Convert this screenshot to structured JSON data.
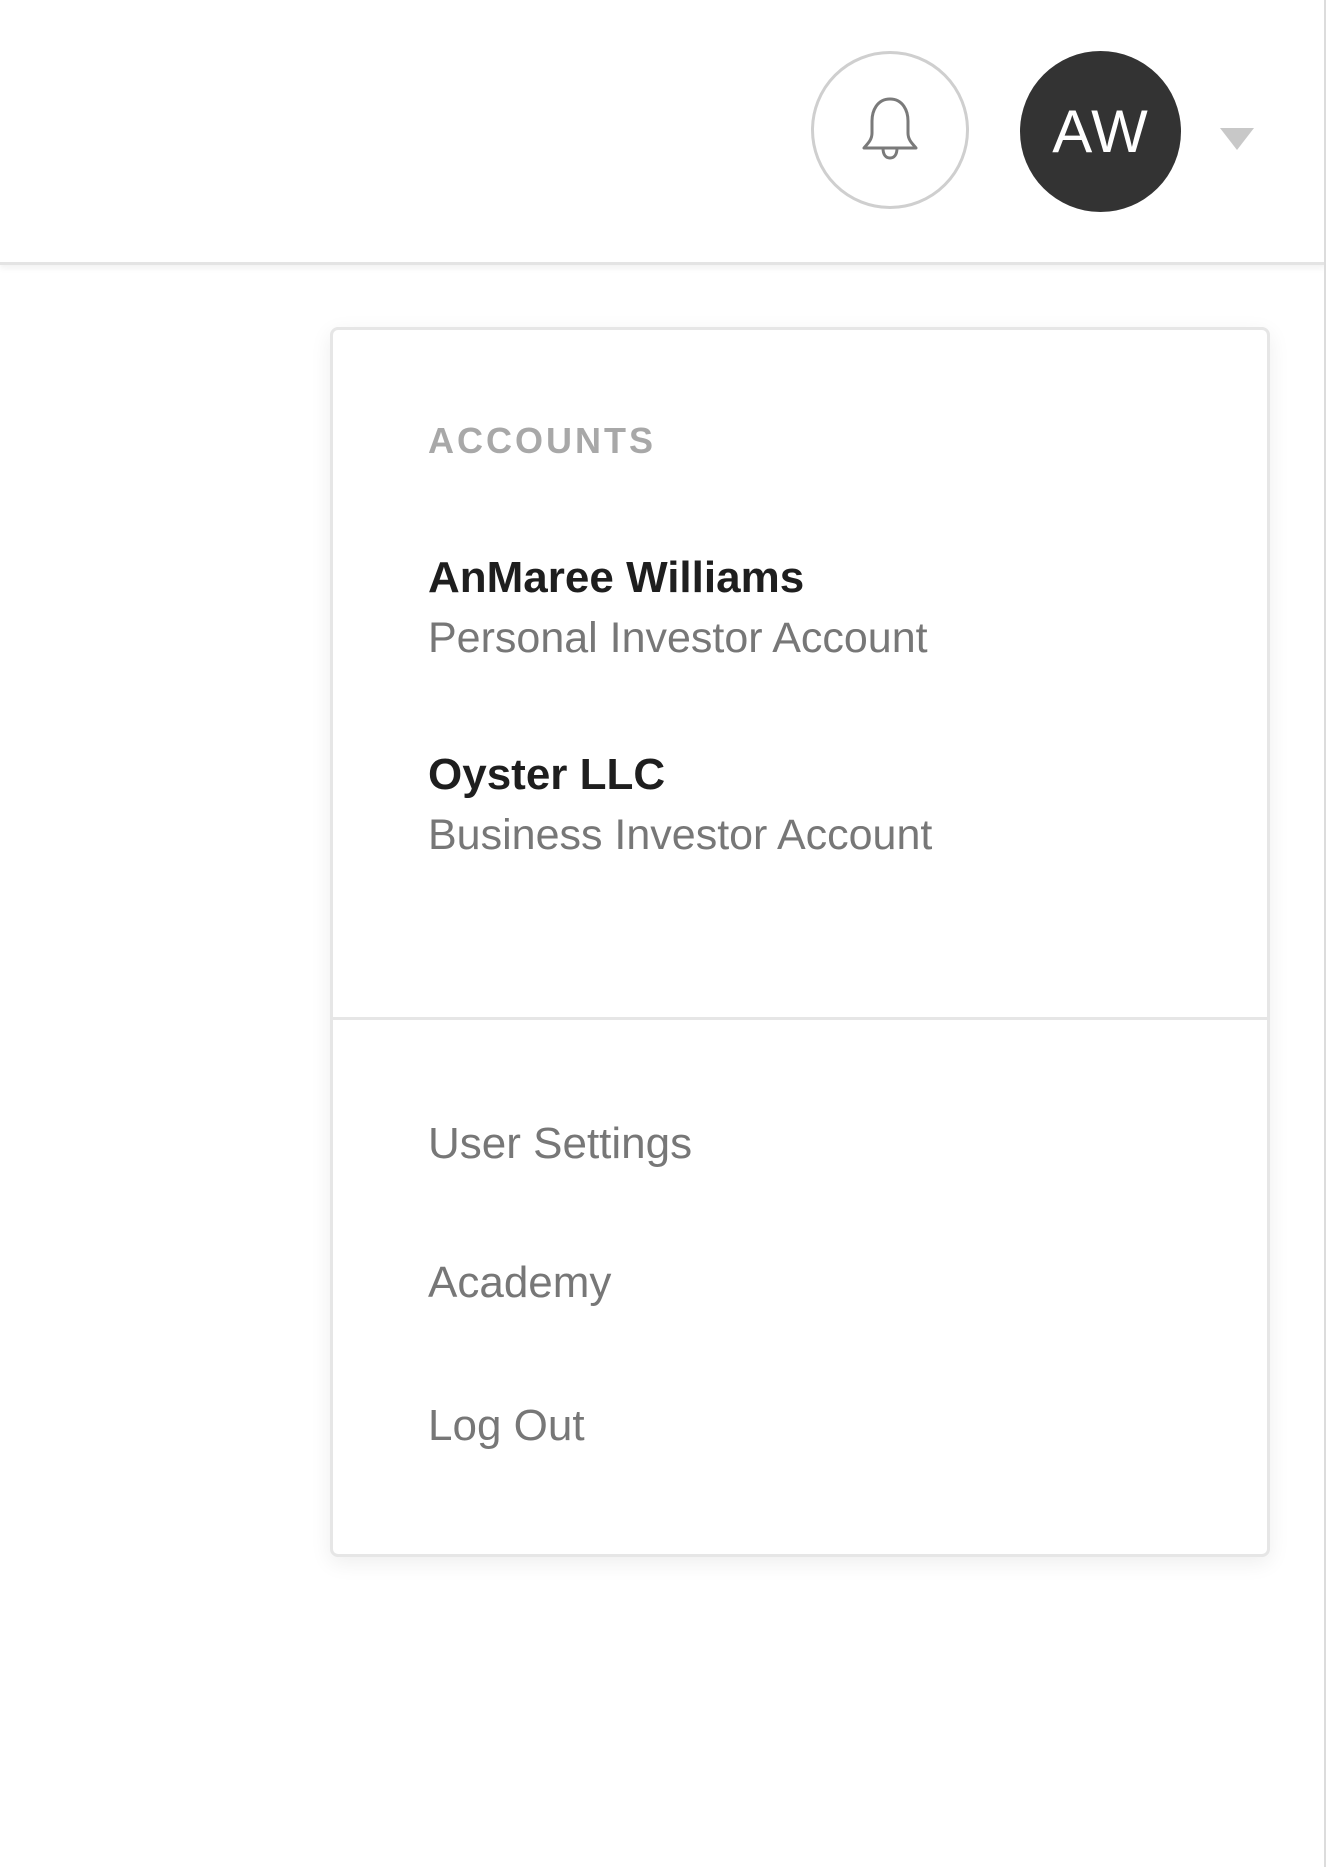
{
  "header": {
    "notifications_icon": "bell-icon",
    "avatar_initials": "AW",
    "dropdown_icon": "caret-down-icon"
  },
  "menu": {
    "accounts_title": "ACCOUNTS",
    "accounts": [
      {
        "name": "AnMaree Williams",
        "type": "Personal Investor Account"
      },
      {
        "name": "Oyster LLC",
        "type": "Business Investor Account"
      }
    ],
    "links": [
      {
        "label": "User Settings"
      },
      {
        "label": "Academy"
      },
      {
        "label": "Log Out"
      }
    ]
  },
  "colors": {
    "avatar_bg": "#333333",
    "muted_text": "#777777",
    "section_title": "#a8a8a8",
    "border": "#e6e6e6"
  }
}
